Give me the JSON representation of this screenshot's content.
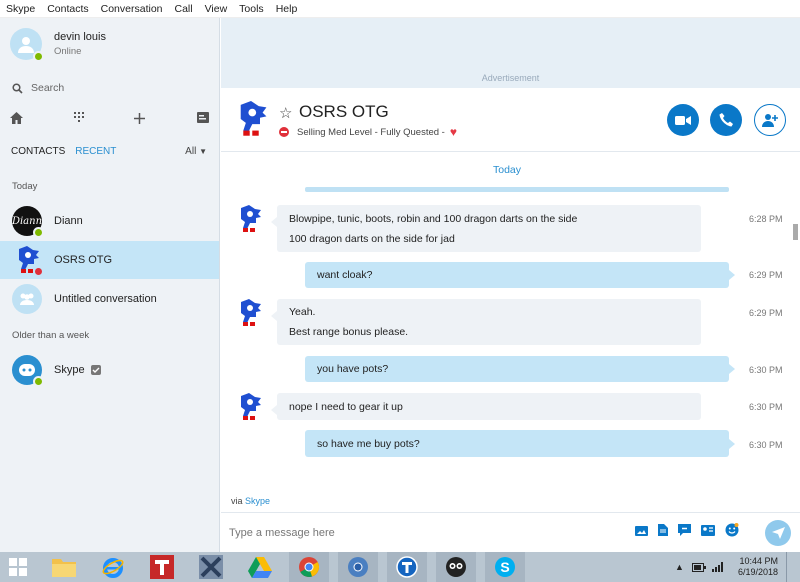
{
  "menu": [
    "Skype",
    "Contacts",
    "Conversation",
    "Call",
    "View",
    "Tools",
    "Help"
  ],
  "profile": {
    "name": "devin louis",
    "status": "Online"
  },
  "search": {
    "placeholder": "Search"
  },
  "tabs": {
    "contacts": "CONTACTS",
    "recent": "RECENT",
    "filter": "All"
  },
  "sections": {
    "today": "Today",
    "older": "Older than a week"
  },
  "contacts": [
    {
      "name": "Diann",
      "status": "online"
    },
    {
      "name": "OSRS OTG",
      "status": "busy",
      "active": true
    },
    {
      "name": "Untitled conversation"
    },
    {
      "name": "Skype",
      "verified": true
    }
  ],
  "ad": {
    "label": "Advertisement"
  },
  "chat": {
    "title": "OSRS OTG",
    "mood": "Selling Med Level - Fully Quested -",
    "day_label": "Today"
  },
  "messages": [
    {
      "dir": "in",
      "lines": [
        "Blowpipe, tunic, boots, robin and 100 dragon darts on the side",
        "100 dragon darts on the side for jad"
      ],
      "time": "6:28 PM"
    },
    {
      "dir": "out",
      "lines": [
        "want cloak?"
      ],
      "time": "6:29 PM"
    },
    {
      "dir": "in",
      "lines": [
        "Yeah.",
        "Best range bonus please."
      ],
      "time": "6:29 PM"
    },
    {
      "dir": "out",
      "lines": [
        "you have pots?"
      ],
      "time": "6:30 PM"
    },
    {
      "dir": "in",
      "lines": [
        "nope I need to gear it up"
      ],
      "time": "6:30 PM"
    },
    {
      "dir": "out",
      "lines": [
        "so have me buy pots?"
      ],
      "time": "6:30 PM"
    }
  ],
  "via": {
    "prefix": "via",
    "link": "Skype"
  },
  "composer": {
    "placeholder": "Type a message here"
  },
  "taskbar": {
    "apps": [
      "start-icon",
      "file-explorer-icon",
      "internet-explorer-icon",
      "t-app-icon",
      "x-app-icon",
      "google-drive-icon",
      "chrome-icon",
      "chrome-blue-icon",
      "t-circle-icon",
      "game-icon",
      "skype-icon"
    ],
    "time": "10:44 PM",
    "date": "6/19/2018"
  },
  "colors": {
    "accent": "#2a8fd0",
    "sidebar": "#eef2f6",
    "outgoing": "#c4e5f7",
    "online": "#7fba00",
    "busy": "#e0303a"
  }
}
